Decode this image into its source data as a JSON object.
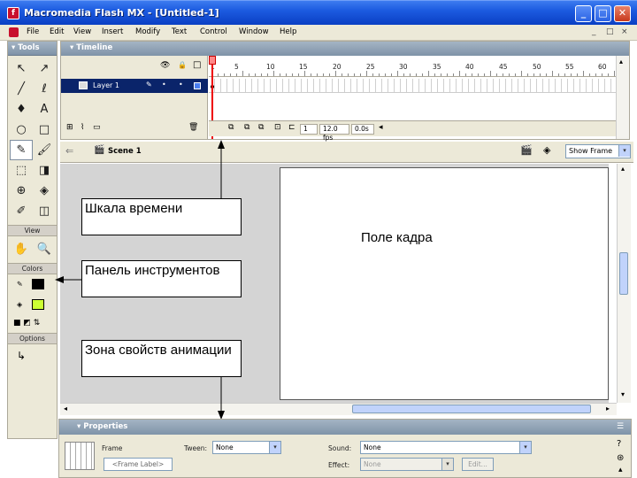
{
  "window": {
    "title": "Macromedia Flash MX - [Untitled-1]",
    "app_glyph": "f",
    "minimize": "_",
    "maximize": "□",
    "close": "✕"
  },
  "menu": {
    "items": [
      "File",
      "Edit",
      "View",
      "Insert",
      "Modify",
      "Text",
      "Control",
      "Window",
      "Help"
    ],
    "mdi": [
      "_",
      "□",
      "×"
    ]
  },
  "tools": {
    "title": "Tools",
    "grid": [
      "↖",
      "↗",
      "╱",
      "ℓ",
      "♦",
      "A",
      "○",
      "□",
      "✎",
      "🖌",
      "⬚",
      "◨",
      "⊕",
      "◈",
      "✐",
      "◫"
    ],
    "view_label": "View",
    "view_tools": [
      "✋",
      "🔍"
    ],
    "colors_label": "Colors",
    "stroke_color": "#000000",
    "fill_color": "#ccff33",
    "options_label": "Options"
  },
  "timeline": {
    "title": "Timeline",
    "layer_name": "Layer 1",
    "frame_numbers": [
      "1",
      "5",
      "10",
      "15",
      "20",
      "25",
      "30",
      "35",
      "40",
      "45",
      "50",
      "55",
      "60"
    ],
    "status": {
      "frame": "1",
      "fps": "12.0 fps",
      "time": "0.0s"
    },
    "layer_icons": [
      "👁",
      "🔒",
      "□"
    ]
  },
  "editbar": {
    "scene": "Scene 1",
    "zoom": "Show Frame"
  },
  "callouts": {
    "timeline": "Шкала времени",
    "toolbox": "Панель инструментов",
    "properties": "Зона свойств анимации",
    "stage": "Поле кадра"
  },
  "properties": {
    "title": "Properties",
    "frame_label": "Frame",
    "frame_placeholder": "<Frame Label>",
    "tween_label": "Tween:",
    "tween_value": "None",
    "sound_label": "Sound:",
    "sound_value": "None",
    "effect_label": "Effect:",
    "effect_value": "None",
    "edit_button": "Edit..."
  },
  "colors": {
    "titlebar": "#0a3fc4",
    "chrome": "#ece9d8",
    "panel_head": "#7f93a8",
    "playhead": "#e00000"
  }
}
